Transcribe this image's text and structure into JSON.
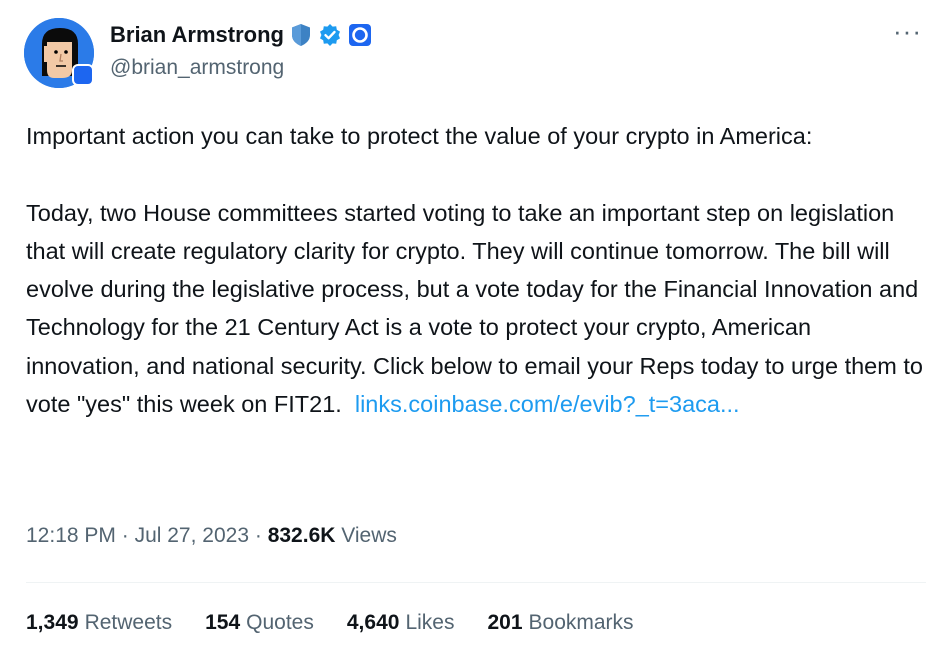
{
  "author": {
    "name": "Brian Armstrong",
    "handle": "@brian_armstrong",
    "avatar_icon": "cartoon-avatar-icon",
    "badges": [
      "shield-badge-icon",
      "verified-badge-icon",
      "coinbase-logo-icon"
    ]
  },
  "menu": {
    "more_label": "···"
  },
  "tweet": {
    "paragraph_1": "Important action you can take to protect the value of your crypto in America:",
    "paragraph_2": "Today, two House committees started voting to take an important step on legislation that will create regulatory clarity for crypto. They will continue tomorrow. The bill will evolve during the legislative process, but a vote today for the Financial Innovation and Technology for the 21 Century Act is a vote to protect your crypto, American innovation, and national security. Click below to email your Reps today to urge them to vote \"yes\" this week on FIT21.",
    "link": "links.coinbase.com/e/evib?_t=3aca..."
  },
  "meta": {
    "time": "12:18 PM",
    "separator": "·",
    "date": "Jul 27, 2023",
    "views_count": "832.6K",
    "views_label": "Views"
  },
  "stats": [
    {
      "count": "1,349",
      "label": "Retweets"
    },
    {
      "count": "154",
      "label": "Quotes"
    },
    {
      "count": "4,640",
      "label": "Likes"
    },
    {
      "count": "201",
      "label": "Bookmarks"
    }
  ],
  "colors": {
    "link": "#1d9bf0",
    "secondary": "#536471",
    "primary": "#0f1419",
    "verified": "#1d9bf0"
  }
}
